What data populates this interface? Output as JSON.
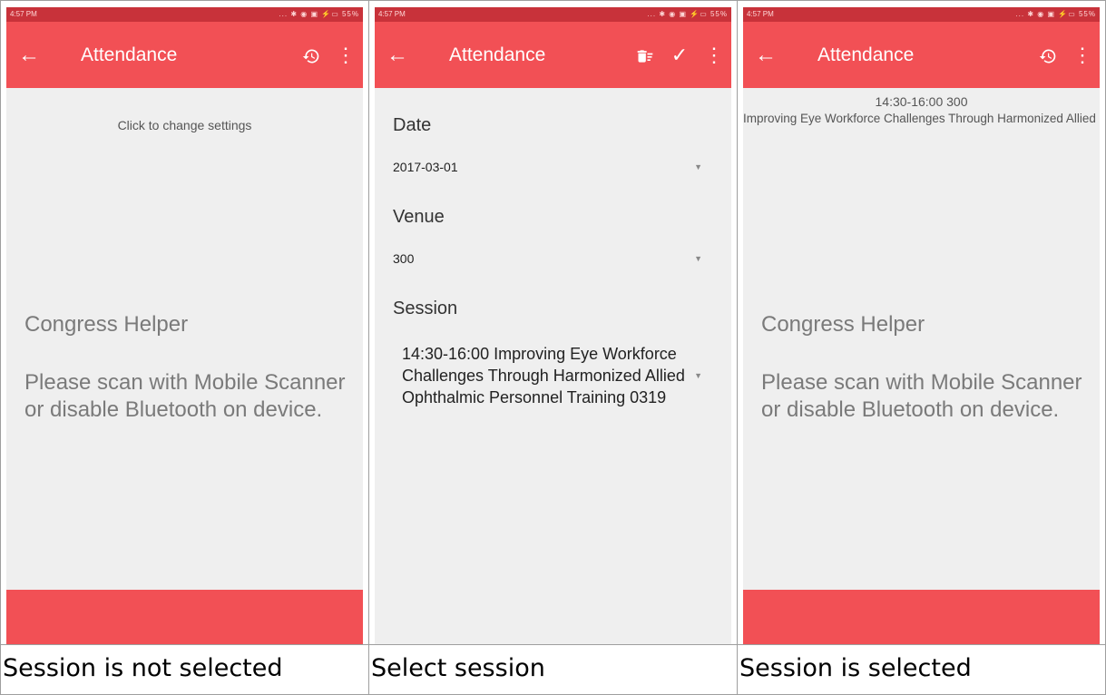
{
  "status_bar": {
    "time": "4:57 PM",
    "indicators": "... ✱ ◉ ▣ ⚡▭ 55%"
  },
  "app": {
    "title": "Attendance",
    "name": "Congress Helper",
    "scan_message": "Please scan with Mobile Scanner or disable Bluetooth on device."
  },
  "icons": {
    "back": "arrow-left",
    "history": "history",
    "menu": "more-vertical",
    "delete": "delete-sweep",
    "confirm": "check"
  },
  "colors": {
    "status_bar": "#c8323a",
    "app_bar": "#f25055",
    "background": "#efefef"
  },
  "screen1": {
    "hint": "Click to change settings",
    "caption": "Session is not selected"
  },
  "screen2": {
    "date_label": "Date",
    "date_value": "2017-03-01",
    "venue_label": "Venue",
    "venue_value": "300",
    "session_label": "Session",
    "session_value": "14:30-16:00 Improving Eye Workforce Challenges Through Harmonized Allied Ophthalmic Personnel Training 0319",
    "caption": "Select session"
  },
  "screen3": {
    "session_time_venue": "14:30-16:00 300",
    "session_title": "Improving Eye Workforce Challenges Through Harmonized Allied Ophthalmic Personnel Training",
    "caption": "Session is selected"
  }
}
